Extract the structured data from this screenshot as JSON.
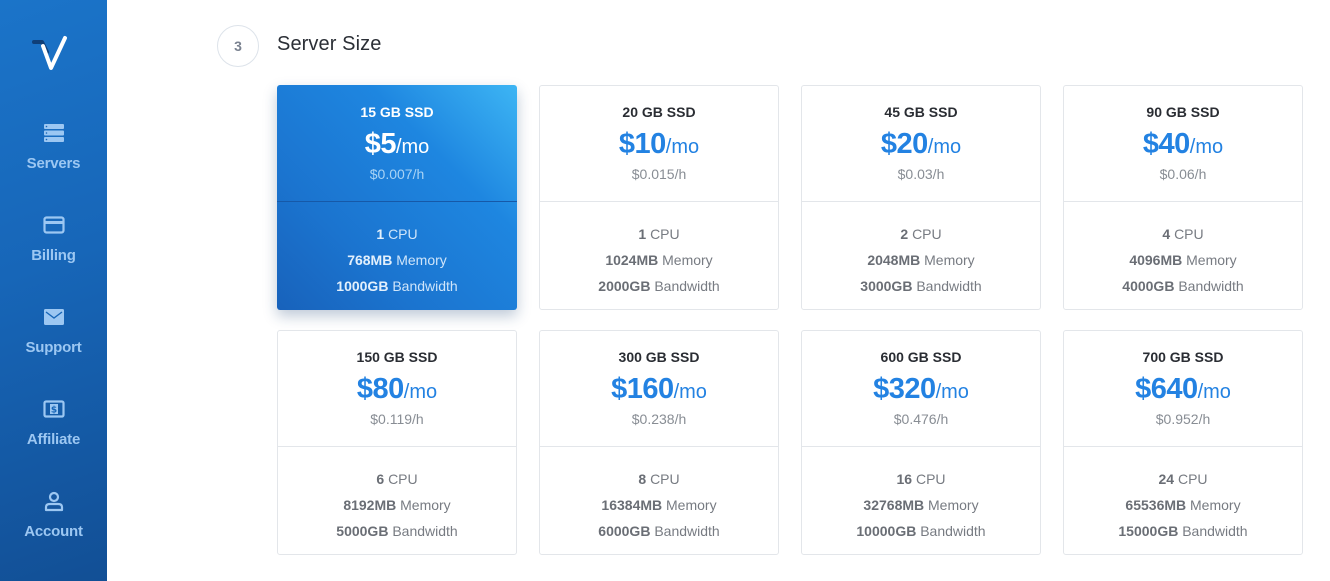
{
  "sidebar": {
    "logo": "vultr-logo",
    "items": [
      {
        "label": "Servers",
        "icon": "server-stack-icon"
      },
      {
        "label": "Billing",
        "icon": "credit-card-icon"
      },
      {
        "label": "Support",
        "icon": "envelope-icon"
      },
      {
        "label": "Affiliate",
        "icon": "dollar-bill-icon"
      },
      {
        "label": "Account",
        "icon": "user-icon"
      }
    ]
  },
  "section": {
    "step_number": "3",
    "title": "Server Size"
  },
  "plans": [
    {
      "storage": "15 GB SSD",
      "price": "$5",
      "unit": "/mo",
      "hourly": "$0.007/h",
      "cpu": "1",
      "cpu_label": "CPU",
      "memory": "768MB",
      "memory_label": "Memory",
      "bandwidth": "1000GB",
      "bandwidth_label": "Bandwidth",
      "selected": true
    },
    {
      "storage": "20 GB SSD",
      "price": "$10",
      "unit": "/mo",
      "hourly": "$0.015/h",
      "cpu": "1",
      "cpu_label": "CPU",
      "memory": "1024MB",
      "memory_label": "Memory",
      "bandwidth": "2000GB",
      "bandwidth_label": "Bandwidth",
      "selected": false
    },
    {
      "storage": "45 GB SSD",
      "price": "$20",
      "unit": "/mo",
      "hourly": "$0.03/h",
      "cpu": "2",
      "cpu_label": "CPU",
      "memory": "2048MB",
      "memory_label": "Memory",
      "bandwidth": "3000GB",
      "bandwidth_label": "Bandwidth",
      "selected": false
    },
    {
      "storage": "90 GB SSD",
      "price": "$40",
      "unit": "/mo",
      "hourly": "$0.06/h",
      "cpu": "4",
      "cpu_label": "CPU",
      "memory": "4096MB",
      "memory_label": "Memory",
      "bandwidth": "4000GB",
      "bandwidth_label": "Bandwidth",
      "selected": false
    },
    {
      "storage": "150 GB SSD",
      "price": "$80",
      "unit": "/mo",
      "hourly": "$0.119/h",
      "cpu": "6",
      "cpu_label": "CPU",
      "memory": "8192MB",
      "memory_label": "Memory",
      "bandwidth": "5000GB",
      "bandwidth_label": "Bandwidth",
      "selected": false
    },
    {
      "storage": "300 GB SSD",
      "price": "$160",
      "unit": "/mo",
      "hourly": "$0.238/h",
      "cpu": "8",
      "cpu_label": "CPU",
      "memory": "16384MB",
      "memory_label": "Memory",
      "bandwidth": "6000GB",
      "bandwidth_label": "Bandwidth",
      "selected": false
    },
    {
      "storage": "600 GB SSD",
      "price": "$320",
      "unit": "/mo",
      "hourly": "$0.476/h",
      "cpu": "16",
      "cpu_label": "CPU",
      "memory": "32768MB",
      "memory_label": "Memory",
      "bandwidth": "10000GB",
      "bandwidth_label": "Bandwidth",
      "selected": false
    },
    {
      "storage": "700 GB SSD",
      "price": "$640",
      "unit": "/mo",
      "hourly": "$0.952/h",
      "cpu": "24",
      "cpu_label": "CPU",
      "memory": "65536MB",
      "memory_label": "Memory",
      "bandwidth": "15000GB",
      "bandwidth_label": "Bandwidth",
      "selected": false
    }
  ],
  "colors": {
    "accent": "#2382e2",
    "sidebar": "#1766b8",
    "sidebar_label": "#9cc7f2"
  }
}
